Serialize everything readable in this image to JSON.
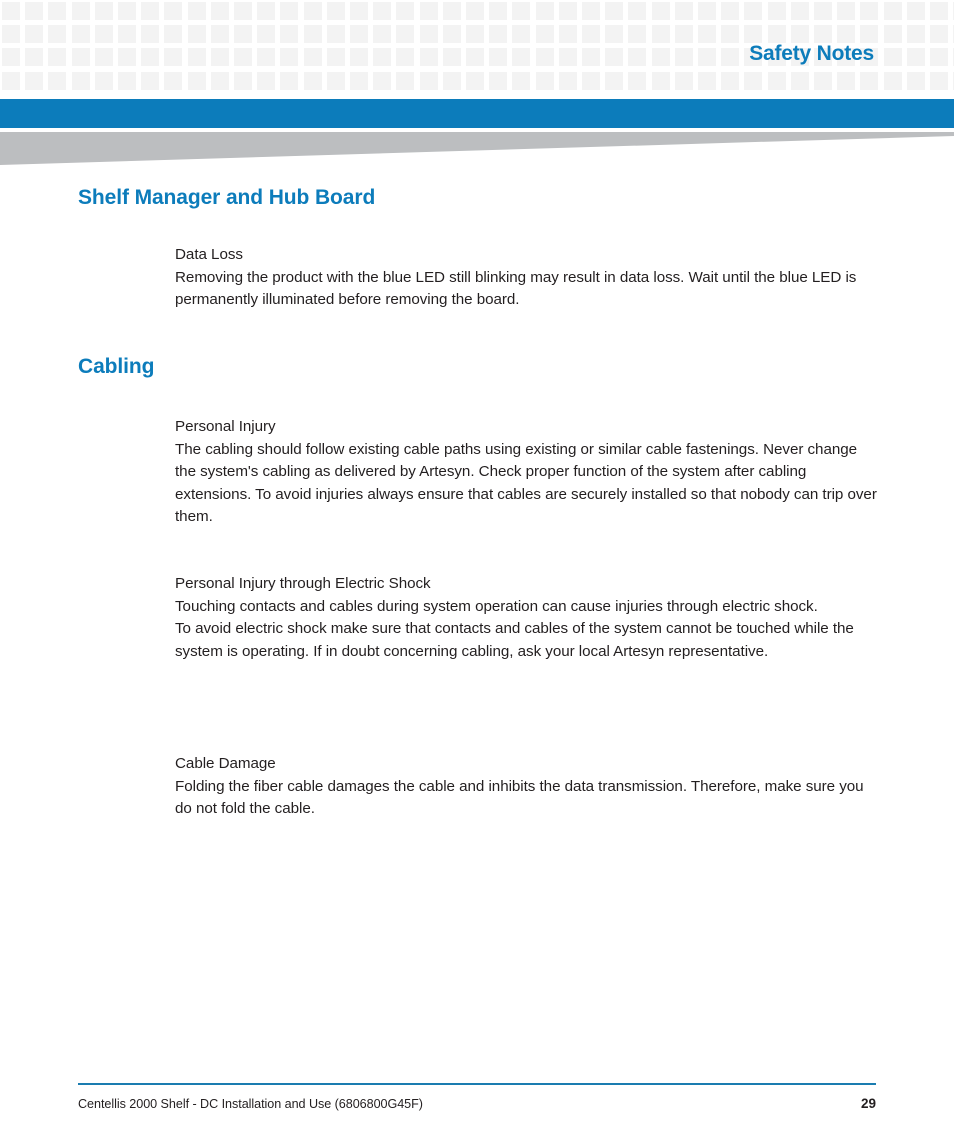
{
  "header": {
    "title": "Safety Notes",
    "accent_color": "#0c7cbb",
    "pattern_color": "#f3f3f3",
    "wedge_color": "#bcbec0"
  },
  "sections": [
    {
      "heading": "Shelf Manager and Hub Board",
      "notes": [
        {
          "title": "Data Loss",
          "body": "Removing the product with the blue LED still blinking may result in data loss. Wait until the blue LED is permanently illuminated before removing the board."
        }
      ]
    },
    {
      "heading": "Cabling",
      "notes": [
        {
          "title": "Personal Injury",
          "body": "The cabling should follow existing cable paths using existing or similar cable fastenings. Never change the system's cabling as delivered by Artesyn. Check proper function of the system after cabling extensions. To avoid injuries always ensure that cables are securely installed so that nobody can trip over them."
        },
        {
          "title": "Personal Injury through Electric Shock",
          "body": "Touching contacts and cables during system operation can cause injuries through electric shock.",
          "body2": "To avoid electric shock make sure that contacts and cables of the system cannot be touched while the system is operating. If in doubt concerning cabling, ask your local Artesyn representative."
        },
        {
          "title": "Cable Damage",
          "body": "Folding the fiber cable damages the cable and inhibits the data transmission. Therefore, make sure you do not fold the cable."
        }
      ]
    }
  ],
  "footer": {
    "document_title": "Centellis 2000 Shelf - DC Installation and Use (6806800G45F)",
    "page_number": "29",
    "rule_color": "#1a7cb0"
  }
}
